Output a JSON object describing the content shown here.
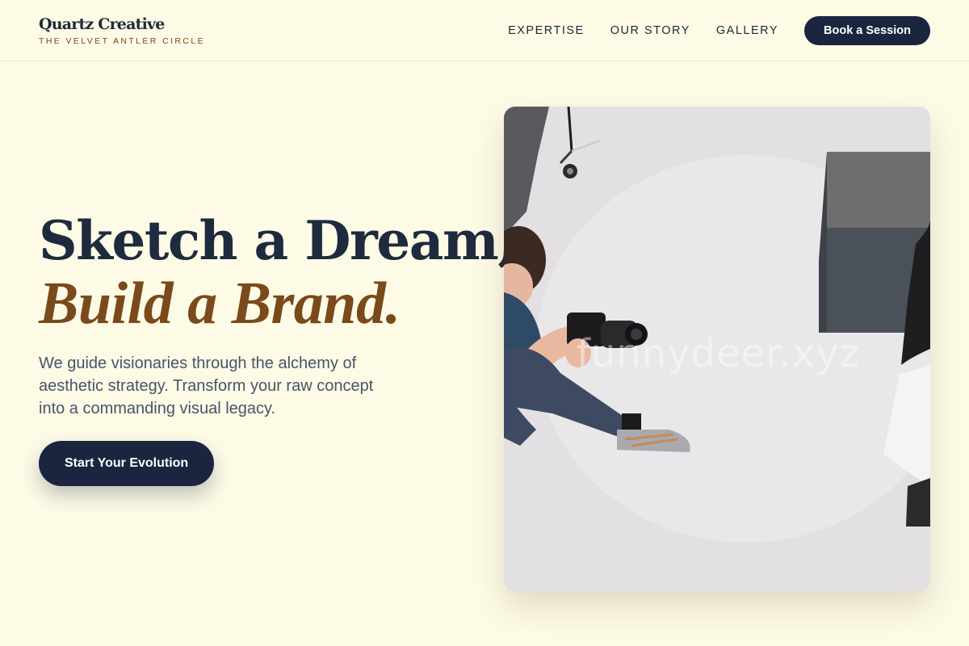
{
  "brand": {
    "name": "Quartz Creative",
    "tagline": "THE VELVET ANTLER CIRCLE"
  },
  "nav": {
    "links": [
      "EXPERTISE",
      "OUR STORY",
      "GALLERY"
    ],
    "cta_label": "Book a Session"
  },
  "hero": {
    "headline_line1": "Sketch a Dream,",
    "headline_line2": "Build a Brand.",
    "subtext": "We guide visionaries through the alchemy of aesthetic strategy. Transform your raw concept into a commanding visual legacy.",
    "cta_label": "Start Your Evolution",
    "image": {
      "watermark": "funnydeer.xyz"
    }
  },
  "colors": {
    "background": "#fdfae6",
    "navy": "#1b2540",
    "accent_brown": "#7a4a1a",
    "body_text": "#475569"
  }
}
